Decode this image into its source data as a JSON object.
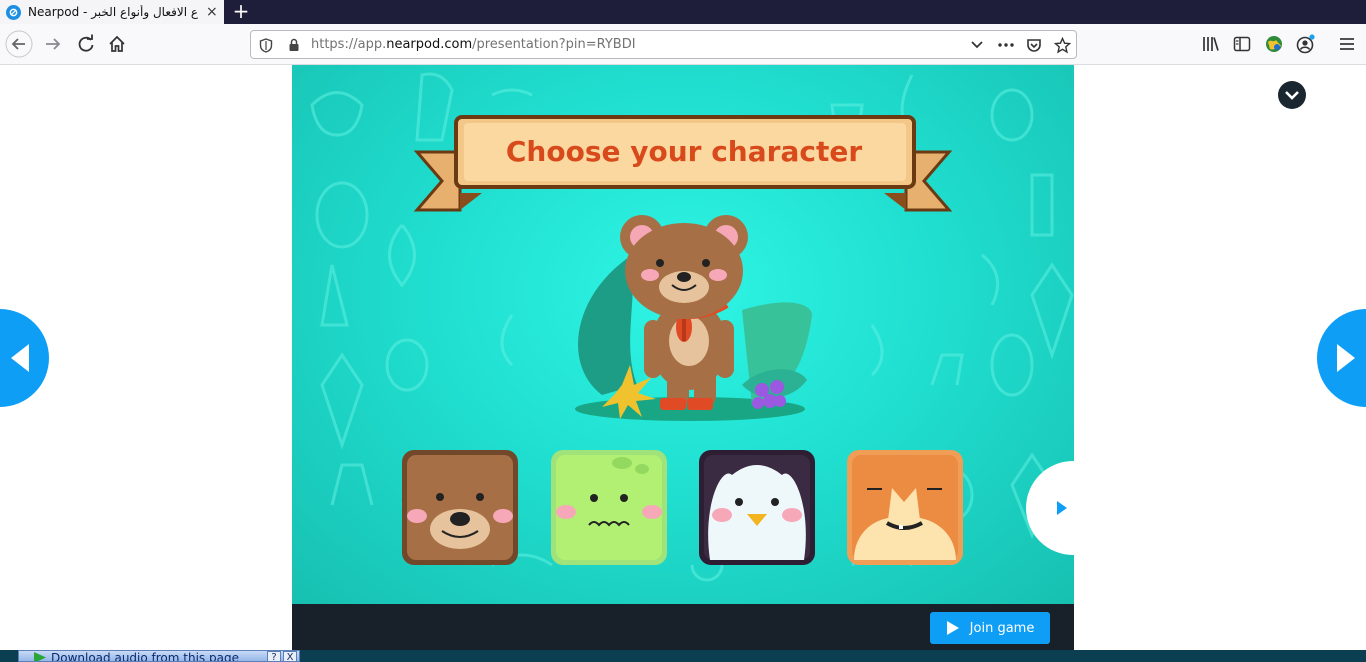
{
  "browser": {
    "tab_title": "Nearpod - اع الافعال وأنواع الخبر",
    "tab_close": "×",
    "new_tab": "+",
    "url_prefix": "https://app.",
    "url_host": "nearpod.com",
    "url_path": "/presentation?pin=RYBDI",
    "menu": "≡"
  },
  "slide": {
    "title": "Choose your character",
    "characters": [
      "bear",
      "frog",
      "penguin",
      "fox"
    ]
  },
  "join_button": {
    "label": "Join game"
  },
  "download_bar": {
    "label": "Download audio from this page",
    "help": "?",
    "close": "X"
  },
  "colors": {
    "accent": "#0f9ef6",
    "slide_bg": "#20dfd0",
    "title_red": "#d84a1b",
    "bottom_bar": "#18202a"
  }
}
